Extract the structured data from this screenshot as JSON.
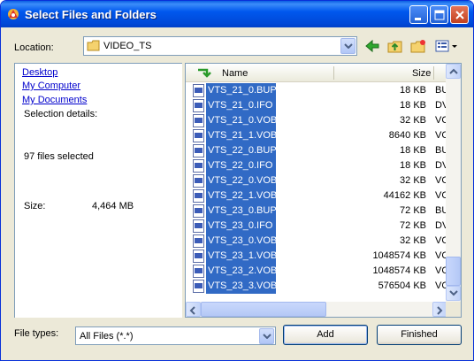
{
  "window": {
    "title": "Select Files and Folders"
  },
  "location": {
    "label": "Location:",
    "value": "VIDEO_TS"
  },
  "left_pane": {
    "links": [
      "Desktop",
      "My Computer",
      "My Documents"
    ],
    "selection_label": "Selection details:",
    "files_selected": "97 files selected",
    "size_label": "Size:",
    "size_value": "4,464 MB"
  },
  "list": {
    "columns": {
      "name": "Name",
      "size": "Size"
    },
    "rows": [
      {
        "name": "VTS_21_0.BUP",
        "size": "18 KB",
        "type": "BU"
      },
      {
        "name": "VTS_21_0.IFO",
        "size": "18 KB",
        "type": "DV"
      },
      {
        "name": "VTS_21_0.VOB",
        "size": "32 KB",
        "type": "VC"
      },
      {
        "name": "VTS_21_1.VOB",
        "size": "8640 KB",
        "type": "VC"
      },
      {
        "name": "VTS_22_0.BUP",
        "size": "18 KB",
        "type": "BU"
      },
      {
        "name": "VTS_22_0.IFO",
        "size": "18 KB",
        "type": "DV"
      },
      {
        "name": "VTS_22_0.VOB",
        "size": "32 KB",
        "type": "VC"
      },
      {
        "name": "VTS_22_1.VOB",
        "size": "44162 KB",
        "type": "VC"
      },
      {
        "name": "VTS_23_0.BUP",
        "size": "72 KB",
        "type": "BU"
      },
      {
        "name": "VTS_23_0.IFO",
        "size": "72 KB",
        "type": "DV"
      },
      {
        "name": "VTS_23_0.VOB",
        "size": "32 KB",
        "type": "VC"
      },
      {
        "name": "VTS_23_1.VOB",
        "size": "1048574 KB",
        "type": "VC"
      },
      {
        "name": "VTS_23_2.VOB",
        "size": "1048574 KB",
        "type": "VC"
      },
      {
        "name": "VTS_23_3.VOB",
        "size": "576504 KB",
        "type": "VC"
      }
    ]
  },
  "file_types": {
    "label": "File types:",
    "value": "All Files (*.*)"
  },
  "buttons": {
    "add": "Add",
    "finished": "Finished"
  },
  "colors": {
    "titlebar": "#0058ee",
    "selection": "#316ac5",
    "link": "#0000cc"
  },
  "icons": [
    "app-icon",
    "minimize-icon",
    "maximize-icon",
    "close-icon",
    "folder-icon",
    "back-icon",
    "up-folder-icon",
    "new-folder-icon",
    "views-icon",
    "sort-arrow-icon",
    "file-icon"
  ]
}
